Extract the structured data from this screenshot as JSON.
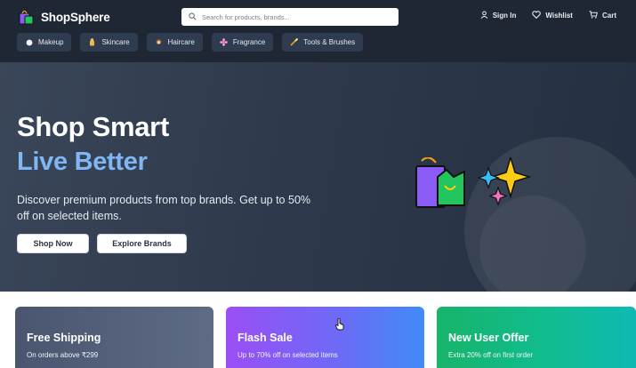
{
  "brand": {
    "name": "ShopSphere"
  },
  "search": {
    "placeholder": "Search for products, brands..."
  },
  "header_actions": [
    {
      "label": "Sign In",
      "icon": "user-icon"
    },
    {
      "label": "Wishlist",
      "icon": "heart-icon"
    },
    {
      "label": "Cart",
      "icon": "cart-icon"
    }
  ],
  "categories": [
    {
      "label": "Makeup",
      "icon": "makeup-icon"
    },
    {
      "label": "Skincare",
      "icon": "skincare-icon"
    },
    {
      "label": "Haircare",
      "icon": "haircare-icon"
    },
    {
      "label": "Fragrance",
      "icon": "fragrance-icon"
    },
    {
      "label": "Tools & Brushes",
      "icon": "brush-icon"
    }
  ],
  "hero": {
    "title_line1": "Shop Smart",
    "title_line2": "Live Better",
    "description": "Discover premium products from top brands. Get up to 50% off on selected items.",
    "primary_button": "Shop Now",
    "secondary_button": "Explore Brands"
  },
  "promos": [
    {
      "title": "Free Shipping",
      "subtitle": "On orders above ₹299"
    },
    {
      "title": "Flash Sale",
      "subtitle": "Up to 70% off on selected items"
    },
    {
      "title": "New User Offer",
      "subtitle": "Extra 20% off on first order"
    }
  ],
  "colors": {
    "header_bg": "#1f2735",
    "accent_blue": "#7fb6f3",
    "flash_sale_gradient": [
      "#9a4ef5",
      "#3f8cf7"
    ],
    "new_user_gradient": [
      "#17b46a",
      "#0fb9b3"
    ]
  }
}
